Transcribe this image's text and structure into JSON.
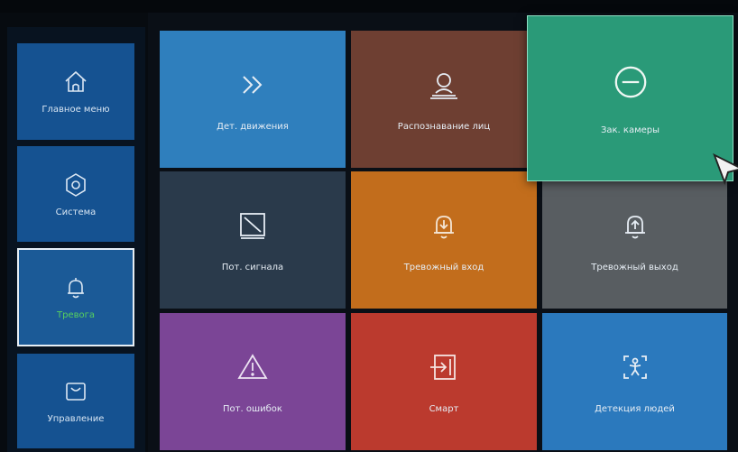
{
  "sidebar": {
    "items": [
      {
        "label": "Главное меню",
        "icon": "home-icon"
      },
      {
        "label": "Система",
        "icon": "settings-gear-icon"
      },
      {
        "label": "Тревога",
        "icon": "bell-icon",
        "selected": true
      },
      {
        "label": "Управление",
        "icon": "bag-icon"
      }
    ]
  },
  "tiles": [
    {
      "label": "Дет. движения",
      "icon": "double-chevron-icon",
      "color": "#2f7fbd"
    },
    {
      "label": "Распознавание лиц",
      "icon": "face-recognition-icon",
      "color": "#6e3f32"
    },
    {
      "label": "Зак. камеры",
      "icon": "minus-circle-icon",
      "color": "#2a9a78",
      "highlighted": true
    },
    {
      "label": "Пот. сигнала",
      "icon": "video-loss-icon",
      "color": "#2a3a4b"
    },
    {
      "label": "Тревожный вход",
      "icon": "alarm-in-icon",
      "color": "#c26d1c"
    },
    {
      "label": "Тревожный выход",
      "icon": "alarm-out-icon",
      "color": "#585d61"
    },
    {
      "label": "Пот. ошибок",
      "icon": "warning-triangle-icon",
      "color": "#7b4596"
    },
    {
      "label": "Смарт",
      "icon": "smart-exit-icon",
      "color": "#bb3a2e"
    },
    {
      "label": "Детекция людей",
      "icon": "person-detection-icon",
      "color": "#2b79bd"
    }
  ],
  "colors": {
    "background": "#070b10",
    "sidebar_item": "#155291",
    "selected_label": "#57d15e"
  }
}
